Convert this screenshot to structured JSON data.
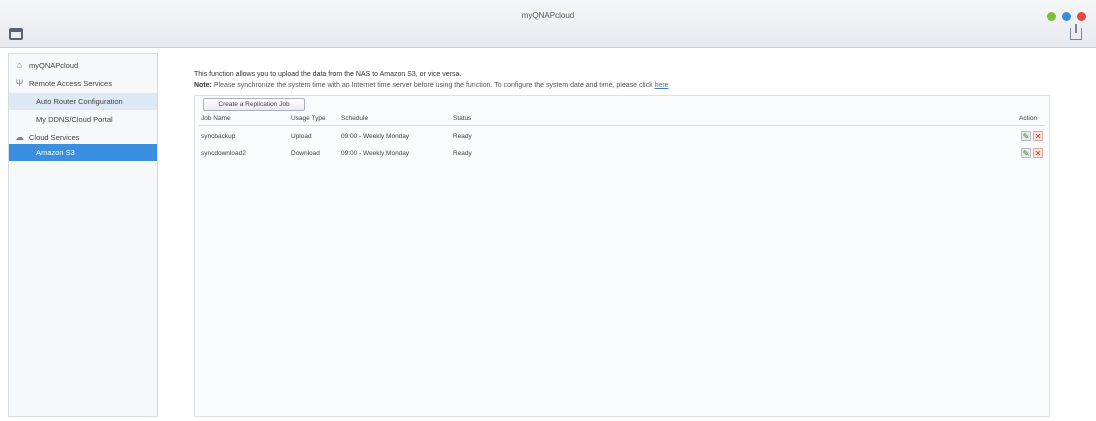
{
  "window": {
    "title": "myQNAPcloud"
  },
  "sidebar": {
    "items": [
      {
        "label": "myQNAPcloud",
        "icon": "home-icon"
      },
      {
        "label": "Remote Access Services",
        "icon": "router-icon"
      },
      {
        "label": "Auto Router Configuration"
      },
      {
        "label": "My DDNS/Cloud Portal"
      },
      {
        "label": "Cloud Services",
        "icon": "cloud-icon"
      },
      {
        "label": "Amazon S3"
      }
    ]
  },
  "main": {
    "intro": "This function allows you to upload the data from the NAS to Amazon S3, or vice versa.",
    "note_prefix": "Note:",
    "note_text": "Please synchronize the system time with an Internet time server before using the function. To configure the system date and time, please click",
    "note_link": "here",
    "create_button": "Create a Replication Job",
    "columns": {
      "job_name": "Job Name",
      "usage_type": "Usage Type",
      "schedule": "Schedule",
      "status": "Status",
      "action": "Action"
    },
    "rows": [
      {
        "job_name": "syncbackup",
        "usage_type": "Upload",
        "schedule": "09:00 - Weekly Monday",
        "status": "Ready"
      },
      {
        "job_name": "syncdownload2",
        "usage_type": "Download",
        "schedule": "09:00 - Weekly Monday",
        "status": "Ready"
      }
    ]
  },
  "colors": {
    "accent": "#3b8fe0",
    "delete": "#d03025",
    "edit": "#3a7a2a"
  }
}
